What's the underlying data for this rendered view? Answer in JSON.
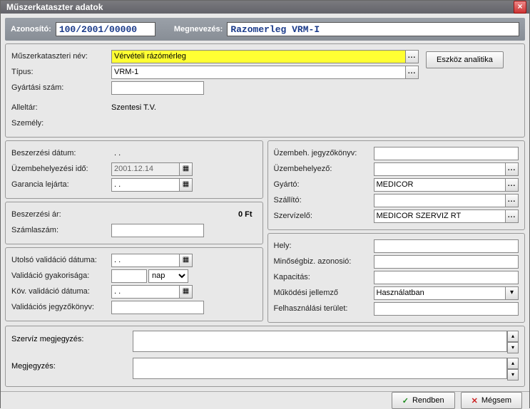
{
  "window": {
    "title": "Műszerkataszter adatok"
  },
  "header": {
    "id_label": "Azonosító:",
    "id_value": "100/2001/00000",
    "name_label": "Megnevezés:",
    "name_value": "Razomerleg VRM-I"
  },
  "fields": {
    "kat_nev_label": "Műszerkataszteri név:",
    "kat_nev_value": "Vérvételi rázómérleg",
    "tipus_label": "Típus:",
    "tipus_value": "VRM-1",
    "gyartasi_label": "Gyártási szám:",
    "gyartasi_value": "",
    "alleltar_label": "Alleltár:",
    "alleltar_value": "Szentesi T.V.",
    "szemely_label": "Személy:",
    "szemely_value": "",
    "eszkoz_btn": "Eszköz analitika"
  },
  "acq": {
    "besz_datum_label": "Beszerzési dátum:",
    "besz_datum_value": ". .",
    "uzem_ido_label": "Üzembehelyezési idő:",
    "uzem_ido_value": "2001.12.14",
    "garancia_label": "Garancia lejárta:",
    "garancia_value": ". .",
    "besz_ar_label": "Beszerzési ár:",
    "besz_ar_value": "0 Ft",
    "szamlaszam_label": "Számlaszám:",
    "szamlaszam_value": ""
  },
  "valid": {
    "utolso_label": "Utolsó validáció dátuma:",
    "utolso_value": ". .",
    "gyak_label": "Validáció gyakorisága:",
    "gyak_value": "",
    "gyak_unit": "nap",
    "kov_label": "Köv. validáció dátuma:",
    "kov_value": ". .",
    "jegy_label": "Validációs jegyzőkönyv:",
    "jegy_value": ""
  },
  "right1": {
    "uzem_jegy_label": "Üzembeh. jegyzőkönyv:",
    "uzem_jegy_value": "",
    "uzembe_label": "Üzembehelyező:",
    "uzembe_value": "",
    "gyarto_label": "Gyártó:",
    "gyarto_value": "MEDICOR",
    "szallito_label": "Szállító:",
    "szallito_value": "",
    "szerviz_label": "Szervízelő:",
    "szerviz_value": "MEDICOR SZERVIZ RT"
  },
  "right2": {
    "hely_label": "Hely:",
    "hely_value": "",
    "minoseg_label": "Minőségbiz. azonosió:",
    "minoseg_value": "",
    "kapacitas_label": "Kapacitás:",
    "kapacitas_value": "",
    "mukodesi_label": "Működési jellemző",
    "mukodesi_value": "Használatban",
    "felh_label": "Felhasználási terület:",
    "felh_value": ""
  },
  "memo": {
    "szerviz_megj_label": "Szervíz megjegyzés:",
    "szerviz_megj_value": "",
    "megj_label": "Megjegyzés:",
    "megj_value": ""
  },
  "buttons": {
    "ok": "Rendben",
    "cancel": "Mégsem"
  }
}
